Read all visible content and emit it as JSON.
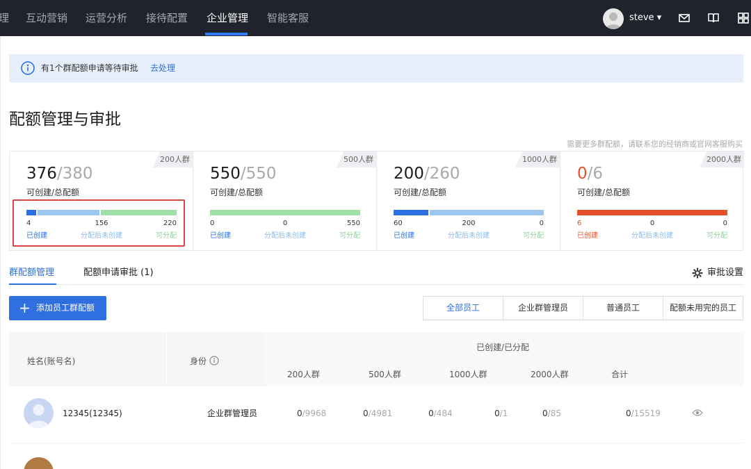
{
  "nav": {
    "items": [
      "理",
      "互动营销",
      "运营分析",
      "接待配置",
      "企业管理",
      "智能客服"
    ],
    "active_index": 4,
    "user": "steve ▾"
  },
  "banner": {
    "text": "有1个群配额申请等待审批",
    "link": "去处理"
  },
  "page": {
    "title": "配额管理与审批",
    "hint": "需要更多群配额，请联系您的经销商或官网客服购买"
  },
  "cards": [
    {
      "tag": "200人群",
      "available": "376",
      "total": "/380",
      "subtitle": "可创建/总配额",
      "values": [
        "4",
        "156",
        "220"
      ],
      "labels": [
        "已创建",
        "分配后未创建",
        "可分配"
      ],
      "fractions": [
        0.0105,
        0.4105,
        0.579
      ]
    },
    {
      "tag": "500人群",
      "available": "550",
      "total": "/550",
      "subtitle": "可创建/总配额",
      "values": [
        "0",
        "0",
        "550"
      ],
      "labels": [
        "已创建",
        "分配后未创建",
        "可分配"
      ],
      "fractions": [
        0,
        0,
        1
      ]
    },
    {
      "tag": "1000人群",
      "available": "200",
      "total": "/260",
      "subtitle": "可创建/总配额",
      "values": [
        "60",
        "200",
        "0"
      ],
      "labels": [
        "已创建",
        "分配后未创建",
        "可分配"
      ],
      "fractions": [
        0.23,
        0.77,
        0
      ]
    },
    {
      "tag": "2000人群",
      "available": "0",
      "total": "/6",
      "subtitle": "可创建/总配额",
      "values": [
        "6",
        "0",
        "0"
      ],
      "labels": [
        "已创建",
        "分配后未创建",
        "可分配"
      ],
      "fractions": [
        1,
        0,
        0
      ]
    }
  ],
  "tabs": {
    "items": [
      "群配额管理",
      "配额申请审批 (1)"
    ],
    "settings": "审批设置"
  },
  "toolbar": {
    "add_label": "添加员工群配额",
    "filters": [
      "全部员工",
      "企业群管理员",
      "普通员工",
      "配额未用完的员工"
    ]
  },
  "table": {
    "col_name": "姓名(账号名)",
    "col_role": "身份",
    "group_header": "已创建/已分配",
    "sub_headers": [
      "200人群",
      "500人群",
      "1000人群",
      "2000人群",
      "合计"
    ],
    "rows": [
      {
        "name": "12345(12345)",
        "role": "企业群管理员",
        "cells": [
          [
            "0",
            "/9968"
          ],
          [
            "0",
            "/4981"
          ],
          [
            "0",
            "/484"
          ],
          [
            "0",
            "/1"
          ],
          [
            "0",
            "/85"
          ],
          [
            "0",
            "/15519"
          ]
        ]
      }
    ]
  },
  "colors": {
    "accent": "#2d6fe0",
    "created": "#2d6fe0",
    "created_red": "#e5502c",
    "pending": "#9cc8f0",
    "available": "#9ee0a9",
    "highlight": "#d9443c"
  }
}
